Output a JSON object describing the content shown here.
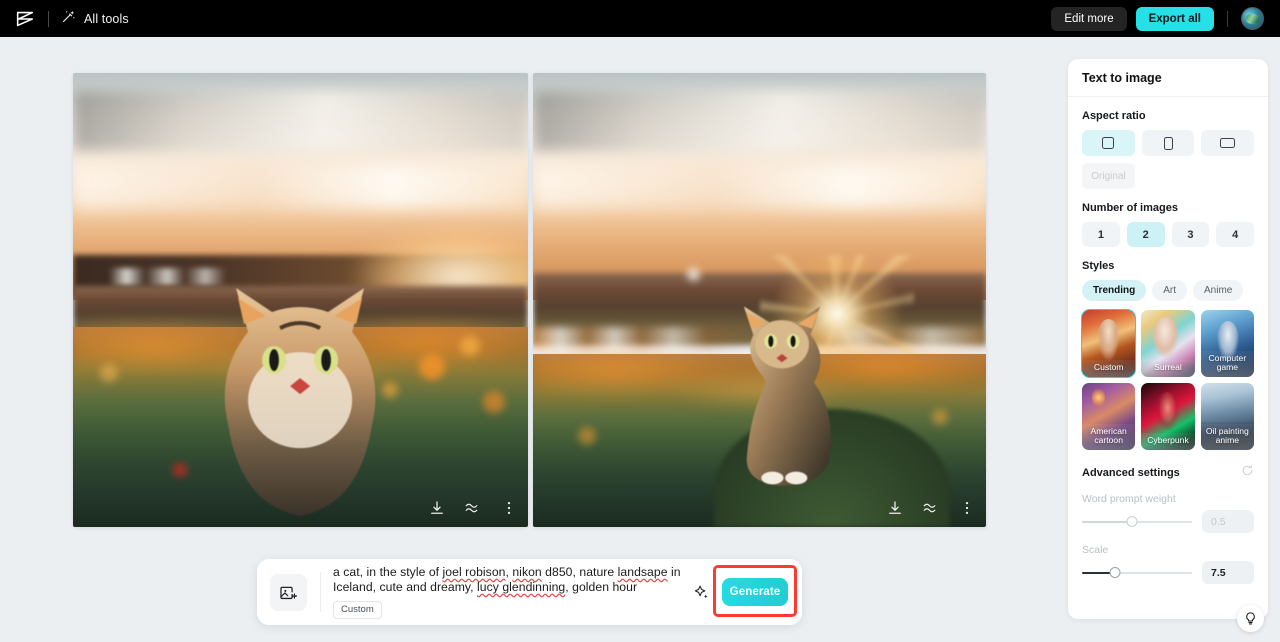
{
  "topbar": {
    "logo_icon": "capcut-logo-icon",
    "all_tools_label": "All tools",
    "all_tools_icon": "magic-wand-icon",
    "edit_more_label": "Edit more",
    "export_all_label": "Export all",
    "avatar_name": "user-avatar",
    "export_color": "#26e0e8"
  },
  "canvas": {
    "images": [
      {
        "alt": "A tabby cat sitting in a sunlit field of grass at golden hour, Iceland landscape",
        "icons": [
          {
            "name": "download-icon",
            "label": "Download"
          },
          {
            "name": "variations-icon",
            "label": "Generate variations"
          },
          {
            "name": "more-options-icon",
            "label": "More"
          }
        ]
      },
      {
        "alt": "A tabby cat sitting on a mossy mound with sunburst on the horizon at golden hour",
        "icons": [
          {
            "name": "download-icon",
            "label": "Download"
          },
          {
            "name": "variations-icon",
            "label": "Generate variations"
          },
          {
            "name": "more-options-icon",
            "label": "More"
          }
        ]
      }
    ]
  },
  "prompt": {
    "add_image_icon": "add-image-icon",
    "text_line1_a": "a cat, in the style of ",
    "text_misspelled_1": "joel robison",
    "text_line1_b": ", ",
    "text_misspelled_2": "nikon",
    "text_line1_c": " d850, nature ",
    "text_misspelled_3": "landsape",
    "text_line1_d": " in",
    "text_line2_a": "Iceland, cute and dreamy, ",
    "text_misspelled_4": "lucy glendinning",
    "text_line2_b": ", golden hour",
    "full_text": "a cat, in the style of joel robison, nikon d850, nature landsape in Iceland, cute and dreamy, lucy glendinning, golden hour",
    "style_chip": "Custom",
    "magic_icon": "sparkle-icon",
    "generate_label": "Generate",
    "generate_highlight_color": "#ff3b30"
  },
  "panel": {
    "title": "Text to image",
    "aspect_ratio": {
      "label": "Aspect ratio",
      "options": [
        {
          "name": "aspect-square",
          "icon": "square-icon",
          "selected": true
        },
        {
          "name": "aspect-portrait",
          "icon": "portrait-icon",
          "selected": false
        },
        {
          "name": "aspect-landscape",
          "icon": "landscape-icon",
          "selected": false
        }
      ],
      "original_label": "Original",
      "original_disabled": true
    },
    "number_of_images": {
      "label": "Number of images",
      "options": [
        "1",
        "2",
        "3",
        "4"
      ],
      "selected": "2"
    },
    "styles": {
      "label": "Styles",
      "tabs": [
        {
          "label": "Trending",
          "selected": true
        },
        {
          "label": "Art",
          "selected": false
        },
        {
          "label": "Anime",
          "selected": false
        }
      ],
      "cards": [
        {
          "label": "Custom",
          "selected": true
        },
        {
          "label": "Surreal",
          "selected": false
        },
        {
          "label": "Computer game",
          "selected": false
        },
        {
          "label": "American cartoon",
          "selected": false
        },
        {
          "label": "Cyberpunk",
          "selected": false
        },
        {
          "label": "Oil painting anime",
          "selected": false
        }
      ]
    },
    "advanced": {
      "label": "Advanced settings",
      "reset_icon": "reset-icon",
      "word_prompt_weight": {
        "label": "Word prompt weight",
        "value": "0.5",
        "disabled": true,
        "percent": 45
      },
      "scale": {
        "label": "Scale",
        "value": "7.5",
        "disabled": false,
        "percent": 30
      }
    },
    "accent_color": "#22d3e0"
  },
  "tips": {
    "icon": "lightbulb-icon",
    "label": "Tips"
  }
}
